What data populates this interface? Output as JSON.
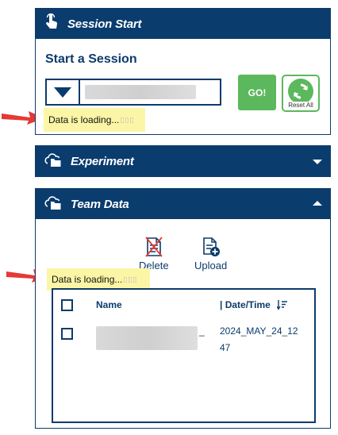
{
  "session": {
    "header_title": "Session Start",
    "heading": "Start a Session",
    "selected_value": "",
    "go_label": "GO!",
    "reset_label": "Reset All",
    "loading_text": "Data is loading...",
    "loading_dots": "▯▯▯"
  },
  "experiment": {
    "header_title": "Experiment"
  },
  "team_data": {
    "header_title": "Team Data",
    "delete_label": "Delete",
    "upload_label": "Upload",
    "loading_text": "Data is loading...",
    "loading_dots": "▯▯▯",
    "columns": {
      "name": "Name",
      "datetime": "| Date/Time"
    },
    "rows": [
      {
        "name_visible_fragment": "_",
        "datetime_line1": "2024_MAY_24_12",
        "datetime_line2": "47"
      }
    ]
  },
  "colors": {
    "header_bg": "#0a3c6e",
    "accent_green": "#5cb85c",
    "loading_highlight": "#fbf6a6",
    "annotation_arrow": "#e53935"
  },
  "icons": {
    "session_header": "hand-pointer-icon",
    "section_header": "cloud-folder-icon",
    "delete": "delete-file-icon",
    "upload": "upload-file-icon",
    "reset": "refresh-icon",
    "sort": "sort-icon"
  }
}
